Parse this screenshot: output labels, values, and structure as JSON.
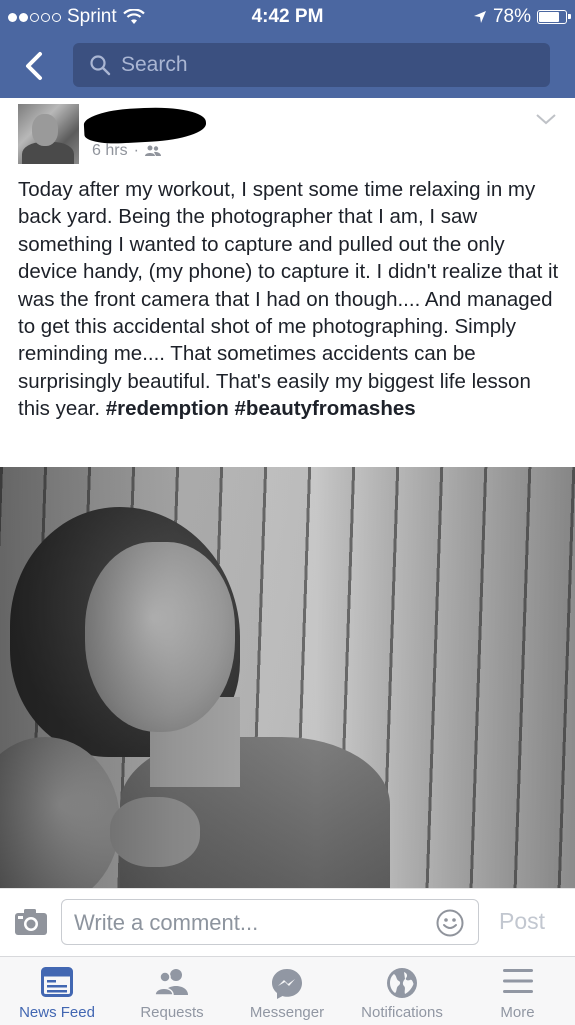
{
  "status_bar": {
    "carrier": "Sprint",
    "time": "4:42 PM",
    "battery": "78%",
    "battery_level": 0.78
  },
  "header": {
    "search_placeholder": "Search"
  },
  "post": {
    "timestamp": "6 hrs",
    "audience_icon": "friends-icon",
    "text_body": "Today after my workout, I spent some time relaxing in my back yard. Being the photographer that I am, I saw something I wanted to capture and pulled out the only device handy, (my phone) to capture it. I didn't realize that it was the front camera that I had on though.... And managed to get this accidental shot of me photographing. Simply reminding me.... That sometimes accidents can be surprisingly beautiful. That's easily my biggest life lesson this year.",
    "hashtags": [
      "#redemption",
      "#beautyfromashes"
    ]
  },
  "comment_bar": {
    "placeholder": "Write a comment...",
    "post_label": "Post"
  },
  "tabs": [
    {
      "label": "News Feed",
      "icon": "news-feed-icon",
      "active": true
    },
    {
      "label": "Requests",
      "icon": "friend-requests-icon",
      "active": false
    },
    {
      "label": "Messenger",
      "icon": "messenger-icon",
      "active": false
    },
    {
      "label": "Notifications",
      "icon": "globe-icon",
      "active": false
    },
    {
      "label": "More",
      "icon": "hamburger-menu-icon",
      "active": false
    }
  ],
  "colors": {
    "brand_blue": "#4b67a1",
    "search_bg": "#3b5080",
    "active_tab": "#4267b2",
    "inactive_tab": "#9197a3"
  }
}
